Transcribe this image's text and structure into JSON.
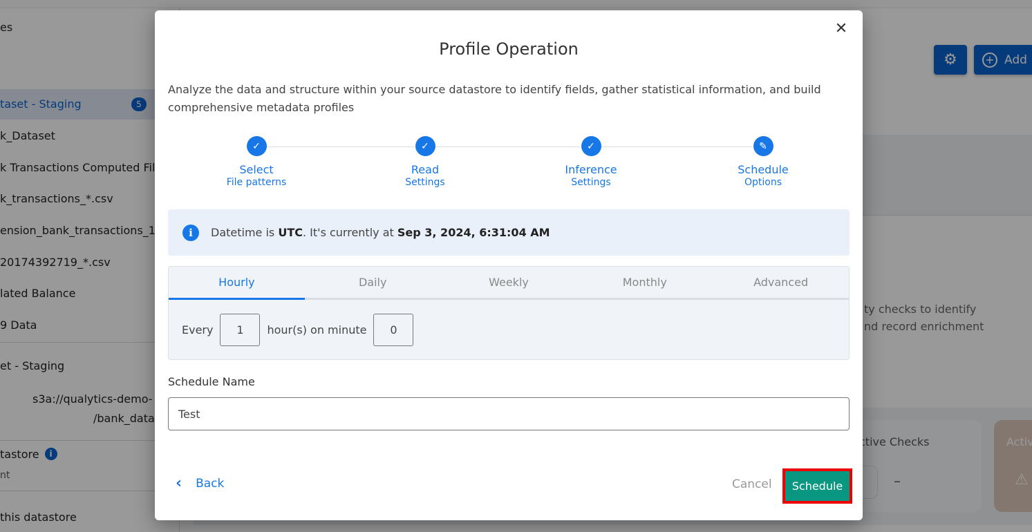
{
  "background": {
    "sidebar": {
      "items": [
        {
          "label": "es"
        },
        {
          "label": "taset - Staging",
          "badge": "5",
          "active": true
        },
        {
          "label": "k_Dataset"
        },
        {
          "label": "k Transactions Computed Fil"
        },
        {
          "label": "k_transactions_*.csv"
        },
        {
          "label": "ension_bank_transactions_1"
        },
        {
          "label": "20174392719_*.csv"
        },
        {
          "label": "lated Balance"
        },
        {
          "label": "9 Data"
        },
        {
          "label": "et - Staging"
        },
        {
          "label": "s3a://qualytics-demo-"
        },
        {
          "label": "/bank_data"
        },
        {
          "label": "tastore"
        },
        {
          "label": "nt"
        },
        {
          "label": "this datastore"
        }
      ]
    },
    "header": {
      "add_label": "Add"
    },
    "description_lines": [
      "ty checks to identify",
      "nd record enrichment"
    ],
    "cards": {
      "active_checks_label": "ctive Checks",
      "active_checks_value": "–",
      "anomalies_label": "Activ"
    }
  },
  "modal": {
    "title": "Profile Operation",
    "description": "Analyze the data and structure within your source datastore to identify fields, gather statistical information, and build comprehensive metadata profiles",
    "steps": [
      {
        "title": "Select",
        "subtitle": "File patterns",
        "state": "done",
        "icon": "check-icon"
      },
      {
        "title": "Read",
        "subtitle": "Settings",
        "state": "done",
        "icon": "check-icon"
      },
      {
        "title": "Inference",
        "subtitle": "Settings",
        "state": "done",
        "icon": "check-icon"
      },
      {
        "title": "Schedule",
        "subtitle": "Options",
        "state": "current",
        "icon": "pencil-icon"
      }
    ],
    "info": {
      "prefix": "Datetime is ",
      "timezone": "UTC",
      "middle": ". It's currently at ",
      "current_time": "Sep 3, 2024, 6:31:04 AM"
    },
    "schedule_tabs": [
      {
        "label": "Hourly",
        "active": true
      },
      {
        "label": "Daily",
        "active": false
      },
      {
        "label": "Weekly",
        "active": false
      },
      {
        "label": "Monthly",
        "active": false
      },
      {
        "label": "Advanced",
        "active": false
      }
    ],
    "hourly": {
      "every_label": "Every",
      "hours_value": "1",
      "middle_label": "hour(s) on minute",
      "minute_value": "0"
    },
    "schedule_name": {
      "label": "Schedule Name",
      "value": "Test"
    },
    "footer": {
      "back_label": "Back",
      "cancel_label": "Cancel",
      "schedule_label": "Schedule"
    }
  },
  "colors": {
    "primary": "#1877e6",
    "schedule_button": "#0a9782",
    "highlight_border": "#ee0000"
  }
}
